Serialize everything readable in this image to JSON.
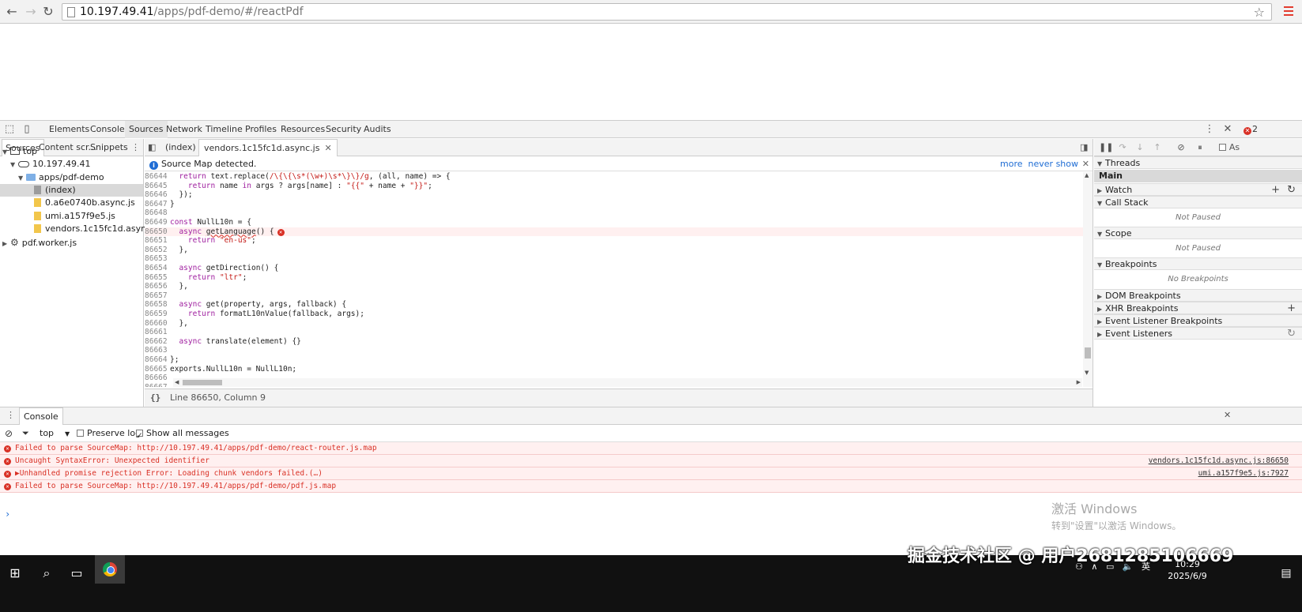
{
  "browser": {
    "url_host": "10.197.49.41",
    "url_path": "/apps/pdf-demo/#/reactPdf"
  },
  "devtools": {
    "tabs": [
      "Elements",
      "Console",
      "Sources",
      "Network",
      "Timeline",
      "Profiles",
      "Resources",
      "Security",
      "Audits"
    ],
    "active_tab": "Sources",
    "error_count": "2",
    "navigator": {
      "tabs": [
        "Sources",
        "Content scr...",
        "Snippets"
      ],
      "tree": [
        {
          "label": "top",
          "indent": 0,
          "arrow": "▼",
          "icon": "frame"
        },
        {
          "label": "10.197.49.41",
          "indent": 1,
          "arrow": "▼",
          "icon": "cloud"
        },
        {
          "label": "apps/pdf-demo",
          "indent": 2,
          "arrow": "▼",
          "icon": "folder"
        },
        {
          "label": "(index)",
          "indent": 3,
          "arrow": "",
          "icon": "file-grey",
          "selected": true
        },
        {
          "label": "0.a6e0740b.async.js",
          "indent": 3,
          "arrow": "",
          "icon": "file"
        },
        {
          "label": "umi.a157f9e5.js",
          "indent": 3,
          "arrow": "",
          "icon": "file"
        },
        {
          "label": "vendors.1c15fc1d.async.js",
          "indent": 3,
          "arrow": "",
          "icon": "file"
        },
        {
          "label": "pdf.worker.js",
          "indent": 0,
          "arrow": "▶",
          "icon": "gear"
        }
      ]
    },
    "editor": {
      "tabs": [
        "(index)",
        "vendors.1c15fc1d.async.js"
      ],
      "infobar_text": "Source Map detected.",
      "infobar_more": "more",
      "infobar_never": "never show",
      "code": [
        {
          "n": "86644",
          "t": "  return text.replace(/\\{\\{\\s*(\\w+)\\s*\\}\\}/g, (all, name) => {"
        },
        {
          "n": "86645",
          "t": "    return name in args ? args[name] : \"{{\" + name + \"}}\";"
        },
        {
          "n": "86646",
          "t": "  });"
        },
        {
          "n": "86647",
          "t": "}"
        },
        {
          "n": "86648",
          "t": ""
        },
        {
          "n": "86649",
          "t": "const NullL10n = {"
        },
        {
          "n": "86650",
          "t": "  async getLanguage() {",
          "error": true
        },
        {
          "n": "86651",
          "t": "    return \"en-us\";"
        },
        {
          "n": "86652",
          "t": "  },"
        },
        {
          "n": "86653",
          "t": ""
        },
        {
          "n": "86654",
          "t": "  async getDirection() {"
        },
        {
          "n": "86655",
          "t": "    return \"ltr\";"
        },
        {
          "n": "86656",
          "t": "  },"
        },
        {
          "n": "86657",
          "t": ""
        },
        {
          "n": "86658",
          "t": "  async get(property, args, fallback) {"
        },
        {
          "n": "86659",
          "t": "    return formatL10nValue(fallback, args);"
        },
        {
          "n": "86660",
          "t": "  },"
        },
        {
          "n": "86661",
          "t": ""
        },
        {
          "n": "86662",
          "t": "  async translate(element) {}"
        },
        {
          "n": "86663",
          "t": ""
        },
        {
          "n": "86664",
          "t": "};"
        },
        {
          "n": "86665",
          "t": "exports.NullL10n = NullL10n;"
        },
        {
          "n": "86666",
          "t": ""
        },
        {
          "n": "86667",
          "t": ""
        }
      ],
      "status_format": "{}",
      "status_position": "Line 86650, Column 9"
    },
    "sidebar": {
      "threads_label": "Threads",
      "threads_main": "Main",
      "watch_label": "Watch",
      "callstack_label": "Call Stack",
      "callstack_body": "Not Paused",
      "scope_label": "Scope",
      "scope_body": "Not Paused",
      "breakpoints_label": "Breakpoints",
      "breakpoints_body": "No Breakpoints",
      "dom_bp_label": "DOM Breakpoints",
      "xhr_bp_label": "XHR Breakpoints",
      "event_bp_label": "Event Listener Breakpoints",
      "event_listeners_label": "Event Listeners",
      "async_label": "As"
    },
    "console": {
      "tab": "Console",
      "context": "top",
      "preserve_log": "Preserve log",
      "show_all": "Show all messages",
      "messages": [
        {
          "text": "Failed to parse SourceMap: http://10.197.49.41/apps/pdf-demo/react-router.js.map",
          "source": ""
        },
        {
          "text": "Uncaught SyntaxError: Unexpected identifier",
          "source": "vendors.1c15fc1d.async.js:86650"
        },
        {
          "text": "▶Unhandled promise rejection Error: Loading chunk vendors failed.(…)",
          "source": "umi.a157f9e5.js:7927"
        },
        {
          "text": "Failed to parse SourceMap: http://10.197.49.41/apps/pdf-demo/pdf.js.map",
          "source": ""
        }
      ],
      "prompt": "›"
    }
  },
  "os": {
    "activate_title": "激活 Windows",
    "activate_sub": "转到\"设置\"以激活 Windows。",
    "site_watermark": "掘金技术社区 @ 用户2681285106669",
    "tray_lang": "英",
    "clock_time": "10:29",
    "clock_date": "2025/6/9"
  }
}
